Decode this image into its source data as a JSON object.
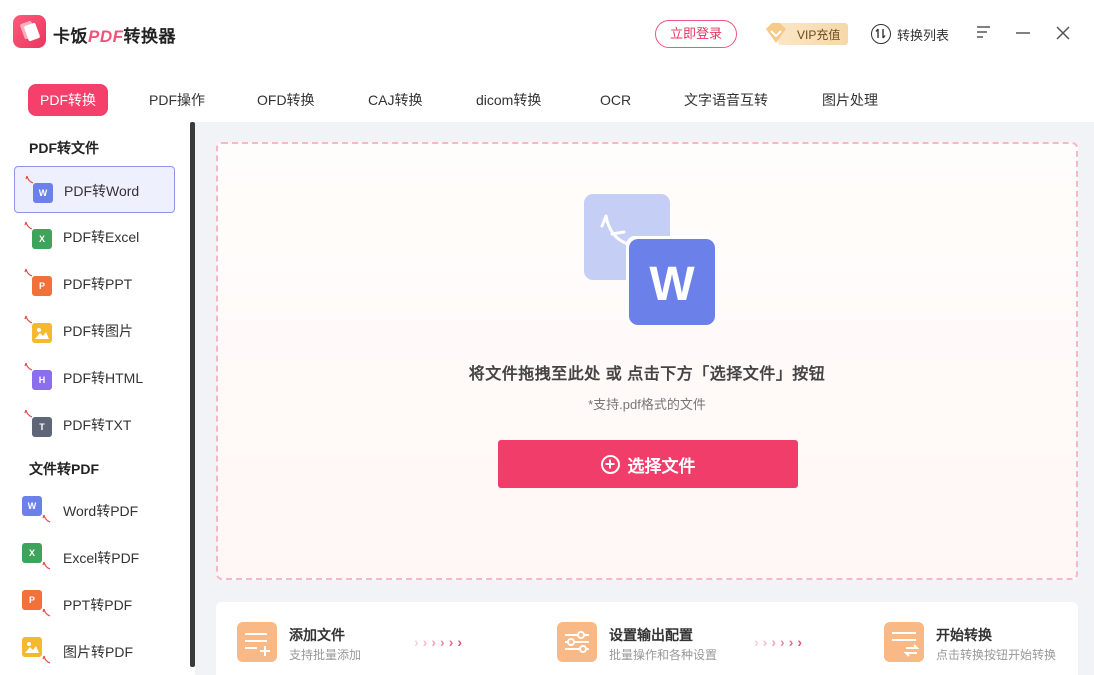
{
  "app": {
    "title_prefix": "卡饭",
    "title_accent": "PDF",
    "title_suffix": "转换器"
  },
  "header": {
    "login_label": "立即登录",
    "vip_label": "VIP充值",
    "convert_list_label": "转换列表"
  },
  "tabs": [
    {
      "label": "PDF转换",
      "active": true
    },
    {
      "label": "PDF操作"
    },
    {
      "label": "OFD转换"
    },
    {
      "label": "CAJ转换"
    },
    {
      "label": "dicom转换"
    },
    {
      "label": "OCR"
    },
    {
      "label": "文字语音互转"
    },
    {
      "label": "图片处理"
    }
  ],
  "sidebar": {
    "section1_title": "PDF转文件",
    "section2_title": "文件转PDF",
    "items1": [
      {
        "label": "PDF转Word",
        "badge": "W",
        "color": "#6b80e8",
        "icon": "word-icon",
        "active": true
      },
      {
        "label": "PDF转Excel",
        "badge": "X",
        "color": "#3ea35b",
        "icon": "excel-icon"
      },
      {
        "label": "PDF转PPT",
        "badge": "P",
        "color": "#f2703a",
        "icon": "ppt-icon"
      },
      {
        "label": "PDF转图片",
        "badge": "",
        "color": "#f6b82e",
        "icon": "image-icon"
      },
      {
        "label": "PDF转HTML",
        "badge": "H",
        "color": "#8b6ef0",
        "icon": "html-icon"
      },
      {
        "label": "PDF转TXT",
        "badge": "T",
        "color": "#5e6677",
        "icon": "txt-icon"
      }
    ],
    "items2": [
      {
        "label": "Word转PDF",
        "badge": "W",
        "color": "#6b80e8",
        "icon": "word-icon"
      },
      {
        "label": "Excel转PDF",
        "badge": "X",
        "color": "#3ea35b",
        "icon": "excel-icon"
      },
      {
        "label": "PPT转PDF",
        "badge": "P",
        "color": "#f2703a",
        "icon": "ppt-icon"
      },
      {
        "label": "图片转PDF",
        "badge": "",
        "color": "#f6b82e",
        "icon": "image-icon"
      }
    ]
  },
  "dropzone": {
    "hero_letter": "W",
    "drag_text": "将文件拖拽至此处 或 点击下方「选择文件」按钮",
    "sub_text": "*支持.pdf格式的文件",
    "select_button_label": "选择文件"
  },
  "steps": [
    {
      "title": "添加文件",
      "desc": "支持批量添加",
      "icon": "add-file-icon"
    },
    {
      "title": "设置输出配置",
      "desc": "批量操作和各种设置",
      "icon": "settings-sliders-icon"
    },
    {
      "title": "开始转换",
      "desc": "点击转换按钮开始转换",
      "icon": "convert-icon"
    }
  ],
  "colors": {
    "accent": "#f03d6a",
    "word_blue": "#6b80e8"
  }
}
